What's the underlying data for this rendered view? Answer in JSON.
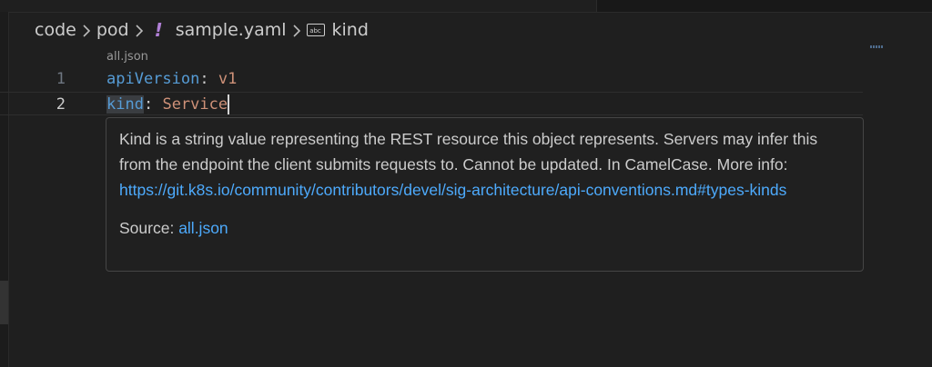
{
  "breadcrumb": {
    "items": [
      "code",
      "pod"
    ],
    "file_icon": "!",
    "file_name": "sample.yaml",
    "symbol_icon_text": "abc",
    "symbol": "kind"
  },
  "codelens": {
    "text": "all.json"
  },
  "editor": {
    "lines": [
      {
        "number": "1",
        "key": "apiVersion",
        "colon": ":",
        "value": "v1"
      },
      {
        "number": "2",
        "key": "kind",
        "colon": ":",
        "value": "Service"
      }
    ]
  },
  "hover": {
    "description": "Kind is a string value representing the REST resource this object represents. Servers may infer this from the endpoint the client submits requests to. Cannot be updated. In CamelCase. More info: ",
    "link": "https://git.k8s.io/community/contributors/devel/sig-architecture/api-conventions.md#types-kinds",
    "source_label": "Source: ",
    "source_link": "all.json"
  },
  "colors": {
    "background": "#1f1f1f",
    "key": "#569cd6",
    "value": "#ce9178",
    "link": "#4daafc",
    "yaml_icon": "#b180d7"
  }
}
